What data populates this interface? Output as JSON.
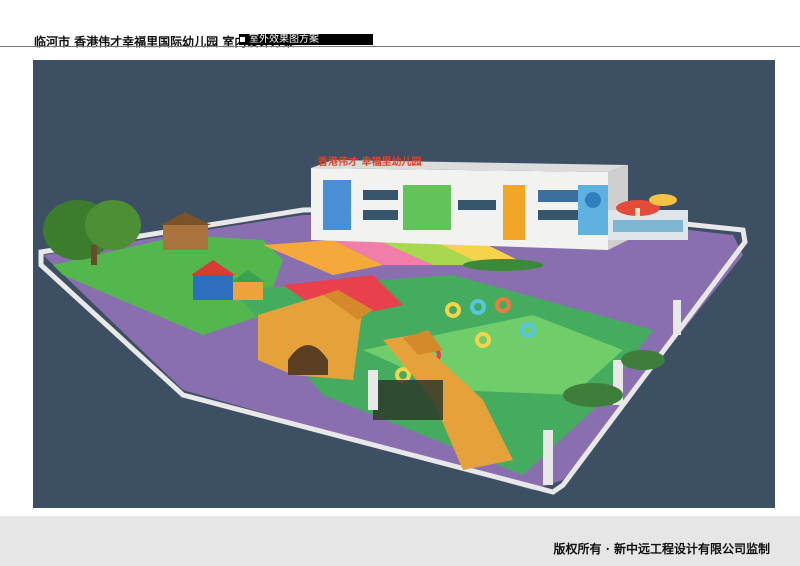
{
  "header": {
    "title": "临河市  香港伟才幸福里国际幼儿园  室内设计方案",
    "section_label": "▪    室外效果图方案"
  },
  "render": {
    "sign_text": "香港伟才 幸福里幼儿园"
  },
  "footer": {
    "copyright": "版权所有 · 新中远工程设计有限公司监制"
  },
  "colors": {
    "background": "#3d4f62",
    "purple_ground": "#8a6fb0",
    "green_lawn": "#4fb358",
    "accent_orange": "#f29a2e"
  }
}
